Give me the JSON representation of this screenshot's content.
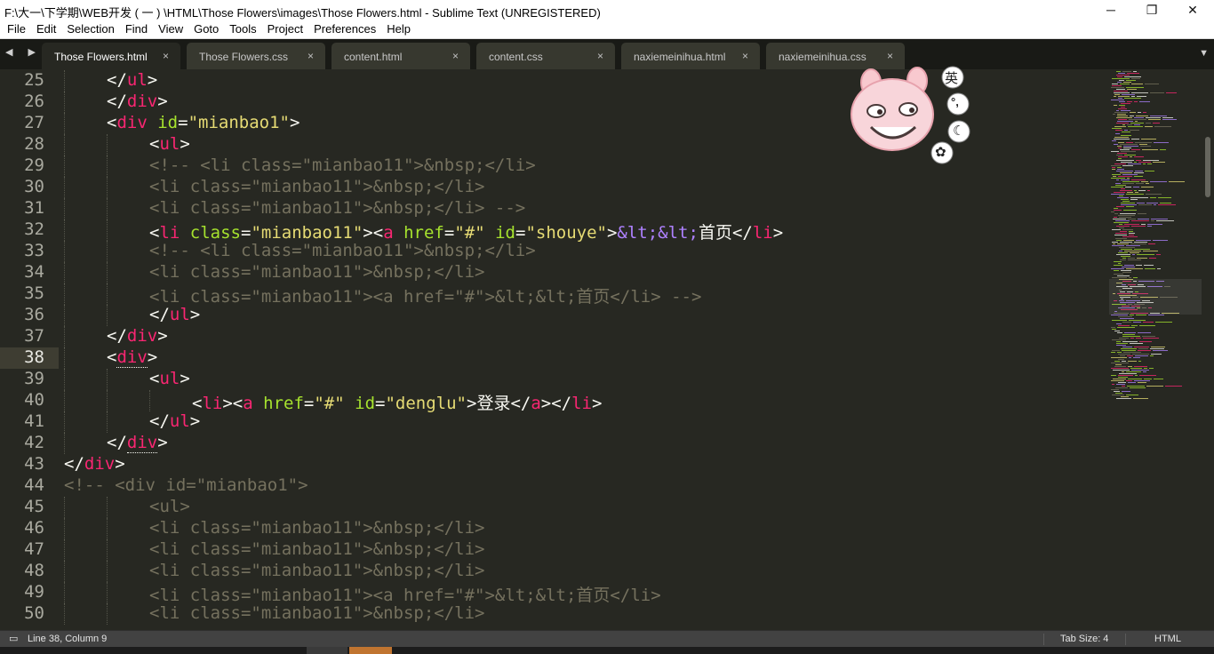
{
  "window": {
    "title": "F:\\大一\\下学期\\WEB开发 ( 一 ) \\HTML\\Those Flowers\\images\\Those Flowers.html - Sublime Text (UNREGISTERED)",
    "minimize": "─",
    "maximize": "❐",
    "close": "✕"
  },
  "menu": [
    "File",
    "Edit",
    "Selection",
    "Find",
    "View",
    "Goto",
    "Tools",
    "Project",
    "Preferences",
    "Help"
  ],
  "tabbar": {
    "nav_arrows": "◀ ▶",
    "tabs": [
      {
        "label": "Those Flowers.html",
        "active": true,
        "close": "×"
      },
      {
        "label": "Those Flowers.css",
        "active": false,
        "close": "×"
      },
      {
        "label": "content.html",
        "active": false,
        "close": "×"
      },
      {
        "label": "content.css",
        "active": false,
        "close": "×"
      },
      {
        "label": "naxiemeinihua.html",
        "active": false,
        "close": "×"
      },
      {
        "label": "naxiemeinihua.css",
        "active": false,
        "close": "×"
      }
    ],
    "menu_icon": "▼"
  },
  "editor": {
    "current_line": 38,
    "line_numbers": [
      "25",
      "26",
      "27",
      "28",
      "29",
      "30",
      "31",
      "32",
      "33",
      "34",
      "35",
      "36",
      "37",
      "38",
      "39",
      "40",
      "41",
      "42",
      "43",
      "44",
      "45",
      "46",
      "47",
      "48",
      "49",
      "50"
    ],
    "colors": {
      "background": "#272822",
      "tag": "#f92672",
      "attr": "#a6e22e",
      "string": "#e6db74",
      "entity": "#ae81ff",
      "comment": "#75715e",
      "text": "#f8f8f2"
    },
    "lines": [
      {
        "indent": 2,
        "tokens": [
          [
            "pl",
            "</"
          ],
          [
            "tg",
            "ul"
          ],
          [
            "pl",
            ">"
          ]
        ]
      },
      {
        "indent": 2,
        "tokens": [
          [
            "pl",
            "</"
          ],
          [
            "tg",
            "div"
          ],
          [
            "pl",
            ">"
          ]
        ]
      },
      {
        "indent": 2,
        "tokens": [
          [
            "pl",
            "<"
          ],
          [
            "tg",
            "div"
          ],
          [
            "pl",
            " "
          ],
          [
            "at",
            "id"
          ],
          [
            "pl",
            "="
          ],
          [
            "st",
            "\"mianbao1\""
          ],
          [
            "pl",
            ">"
          ]
        ]
      },
      {
        "indent": 4,
        "tokens": [
          [
            "pl",
            "<"
          ],
          [
            "tg",
            "ul"
          ],
          [
            "pl",
            ">"
          ]
        ]
      },
      {
        "indent": 4,
        "tokens": [
          [
            "cm",
            "<!-- <li class=\"mianbao11\">&nbsp;</li>"
          ]
        ]
      },
      {
        "indent": 4,
        "tokens": [
          [
            "cm",
            "<li class=\"mianbao11\">&nbsp;</li>"
          ]
        ]
      },
      {
        "indent": 4,
        "tokens": [
          [
            "cm",
            "<li class=\"mianbao11\">&nbsp;</li> -->"
          ]
        ]
      },
      {
        "indent": 4,
        "tokens": [
          [
            "pl",
            "<"
          ],
          [
            "tg",
            "li"
          ],
          [
            "pl",
            " "
          ],
          [
            "at",
            "class"
          ],
          [
            "pl",
            "="
          ],
          [
            "st",
            "\"mianbao11\""
          ],
          [
            "pl",
            ">"
          ],
          [
            "pl",
            "<"
          ],
          [
            "tg",
            "a"
          ],
          [
            "pl",
            " "
          ],
          [
            "at",
            "href"
          ],
          [
            "pl",
            "="
          ],
          [
            "st",
            "\"#\""
          ],
          [
            "pl",
            " "
          ],
          [
            "at",
            "id"
          ],
          [
            "pl",
            "="
          ],
          [
            "st",
            "\"shouye\""
          ],
          [
            "pl",
            ">"
          ],
          [
            "en",
            "&lt;&lt;"
          ],
          [
            "pl",
            "首页</"
          ],
          [
            "tg",
            "li"
          ],
          [
            "pl",
            ">"
          ]
        ]
      },
      {
        "indent": 4,
        "tokens": [
          [
            "cm",
            "<!-- <li class=\"mianbao11\">&nbsp;</li>"
          ]
        ]
      },
      {
        "indent": 4,
        "tokens": [
          [
            "cm",
            "<li class=\"mianbao11\">&nbsp;</li>"
          ]
        ]
      },
      {
        "indent": 4,
        "tokens": [
          [
            "cm",
            "<li class=\"mianbao11\"><a href=\"#\">&lt;&lt;首页</li> -->"
          ]
        ]
      },
      {
        "indent": 4,
        "tokens": [
          [
            "pl",
            "</"
          ],
          [
            "tg",
            "ul"
          ],
          [
            "pl",
            ">"
          ]
        ]
      },
      {
        "indent": 2,
        "tokens": [
          [
            "pl",
            "</"
          ],
          [
            "tg",
            "div"
          ],
          [
            "pl",
            ">"
          ]
        ]
      },
      {
        "indent": 2,
        "tokens": [
          [
            "pl",
            "<"
          ],
          [
            "tg",
            "div",
            "ul"
          ],
          [
            "pl",
            ">"
          ]
        ]
      },
      {
        "indent": 4,
        "tokens": [
          [
            "pl",
            "<"
          ],
          [
            "tg",
            "ul"
          ],
          [
            "pl",
            ">"
          ]
        ]
      },
      {
        "indent": 6,
        "tokens": [
          [
            "pl",
            "<"
          ],
          [
            "tg",
            "li"
          ],
          [
            "pl",
            "><"
          ],
          [
            "tg",
            "a"
          ],
          [
            "pl",
            " "
          ],
          [
            "at",
            "href"
          ],
          [
            "pl",
            "="
          ],
          [
            "st",
            "\"#\""
          ],
          [
            "pl",
            " "
          ],
          [
            "at",
            "id"
          ],
          [
            "pl",
            "="
          ],
          [
            "st",
            "\"denglu\""
          ],
          [
            "pl",
            ">登录</"
          ],
          [
            "tg",
            "a"
          ],
          [
            "pl",
            "></"
          ],
          [
            "tg",
            "li"
          ],
          [
            "pl",
            ">"
          ]
        ]
      },
      {
        "indent": 4,
        "tokens": [
          [
            "pl",
            "</"
          ],
          [
            "tg",
            "ul"
          ],
          [
            "pl",
            ">"
          ]
        ]
      },
      {
        "indent": 2,
        "tokens": [
          [
            "pl",
            "</"
          ],
          [
            "tg",
            "div",
            "ul"
          ],
          [
            "pl",
            ">"
          ]
        ]
      },
      {
        "indent": 0,
        "tokens": [
          [
            "pl",
            "</"
          ],
          [
            "tg",
            "div"
          ],
          [
            "pl",
            ">"
          ]
        ]
      },
      {
        "indent": 0,
        "tokens": [
          [
            "cm",
            "<!-- <div id=\"mianbao1\">"
          ]
        ]
      },
      {
        "indent": 4,
        "tokens": [
          [
            "cm",
            "<ul>"
          ]
        ]
      },
      {
        "indent": 4,
        "tokens": [
          [
            "cm",
            "<li class=\"mianbao11\">&nbsp;</li>"
          ]
        ]
      },
      {
        "indent": 4,
        "tokens": [
          [
            "cm",
            "<li class=\"mianbao11\">&nbsp;</li>"
          ]
        ]
      },
      {
        "indent": 4,
        "tokens": [
          [
            "cm",
            "<li class=\"mianbao11\">&nbsp;</li>"
          ]
        ]
      },
      {
        "indent": 4,
        "tokens": [
          [
            "cm",
            "<li class=\"mianbao11\"><a href=\"#\">&lt;&lt;首页</li>"
          ]
        ]
      },
      {
        "indent": 4,
        "tokens": [
          [
            "cm",
            "<li class=\"mianbao11\">&nbsp;</li>"
          ]
        ]
      }
    ]
  },
  "ime": {
    "mode": "英",
    "punct": "°,",
    "moon": "☾",
    "settings": "✿"
  },
  "statusbar": {
    "position": "Line 38, Column 9",
    "tab_size": "Tab Size: 4",
    "syntax": "HTML"
  }
}
